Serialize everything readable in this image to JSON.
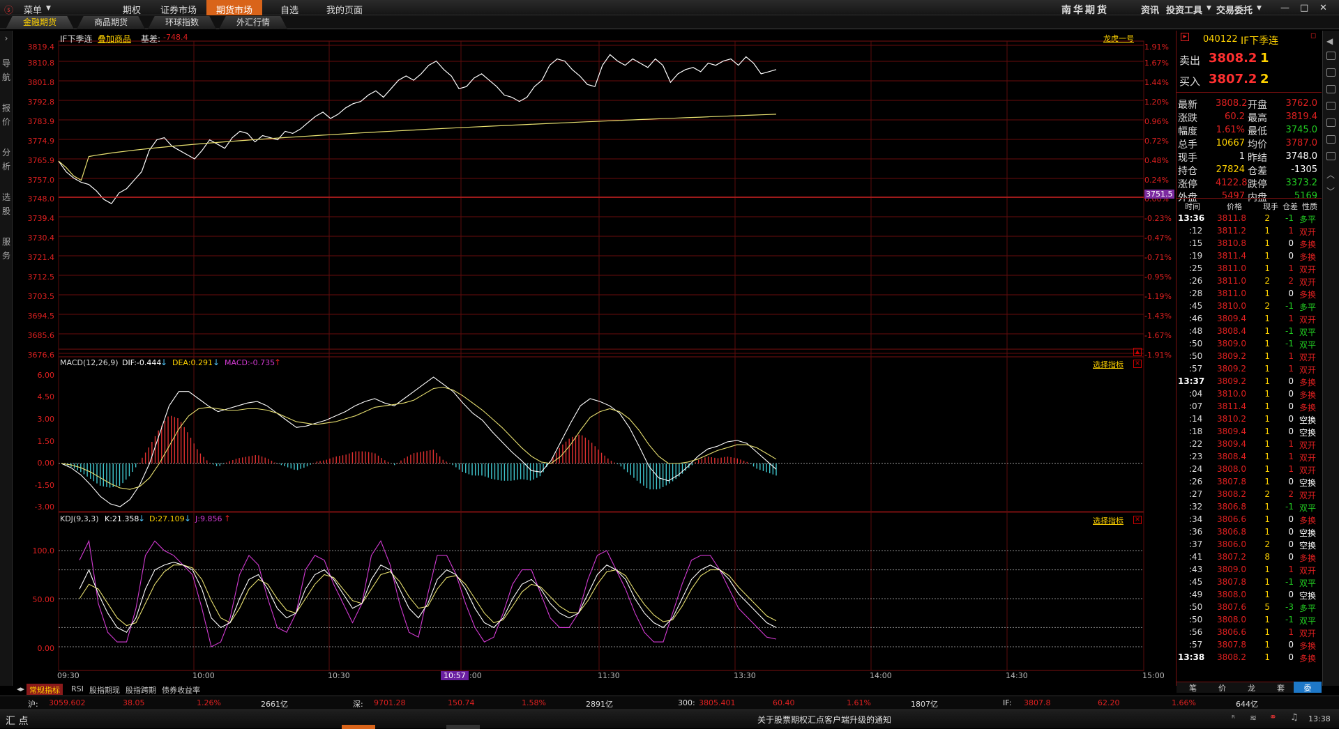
{
  "menubar": {
    "menu": "菜单",
    "items": [
      "期权",
      "证券市场",
      "期货市场",
      "自选",
      "我的页面"
    ],
    "brand": "南华期货",
    "right": [
      "资讯",
      "投资工具",
      "交易委托"
    ]
  },
  "subtabs": [
    "金融期货",
    "商品期货",
    "环球指数",
    "外汇行情"
  ],
  "left_strip": [
    "导",
    "航",
    "报",
    "价",
    "分",
    "析",
    "选",
    "股",
    "服",
    "务"
  ],
  "header": {
    "symbol": "IF下季连",
    "overlay": "叠加商品",
    "basis_label": "基差:",
    "basis": "-748.4",
    "dragon": "龙虎一号"
  },
  "price_axis": {
    "left": [
      "3819.4",
      "3810.8",
      "3801.8",
      "3792.8",
      "3783.9",
      "3774.9",
      "3765.9",
      "3757.0",
      "3748.0",
      "3739.4",
      "3730.4",
      "3721.4",
      "3712.5",
      "3703.5",
      "3694.5",
      "3685.6",
      "3676.6"
    ],
    "right": [
      "1.91%",
      "1.67%",
      "1.44%",
      "1.20%",
      "0.96%",
      "0.72%",
      "0.48%",
      "0.24%",
      "0.00%",
      "-0.23%",
      "-0.47%",
      "-0.71%",
      "-0.95%",
      "-1.19%",
      "-1.43%",
      "-1.67%",
      "-1.91%"
    ],
    "badge": "3751.5"
  },
  "macd": {
    "title": "MACD(12,26,9)",
    "dif": "DIF:-0.444",
    "dea": "DEA:0.291",
    "macd": "MACD:-0.735",
    "select": "选择指标",
    "axis": [
      "6.00",
      "4.50",
      "3.00",
      "1.50",
      "0.00",
      "-1.50",
      "-3.00"
    ]
  },
  "kdj": {
    "title": "KDJ(9,3,3)",
    "k": "K:21.358",
    "d": "D:27.109",
    "j": "J:9.856",
    "select": "选择指标",
    "axis": [
      "100.0",
      "50.00",
      "0.00"
    ]
  },
  "time_axis": [
    "09:30",
    "10:00",
    "10:30",
    "11:00",
    "11:30",
    "13:30",
    "14:00",
    "14:30",
    "15:00"
  ],
  "cursor_time": "10:57",
  "bottom_tabs": [
    "常规指标",
    "RSI",
    "股指期现",
    "股指跨期",
    "债券收益率"
  ],
  "quote": {
    "code": "040122",
    "name": "IF下季连",
    "sell_label": "卖出",
    "sell_price": "3808.2",
    "sell_vol": "1",
    "buy_label": "买入",
    "buy_price": "3807.2",
    "buy_vol": "2",
    "stats": [
      [
        "最新",
        "3808.2",
        "开盘",
        "3762.0"
      ],
      [
        "涨跌",
        "60.2",
        "最高",
        "3819.4"
      ],
      [
        "幅度",
        "1.61%",
        "最低",
        "3745.0"
      ],
      [
        "总手",
        "10667",
        "均价",
        "3787.0"
      ],
      [
        "现手",
        "1",
        "昨结",
        "3748.0"
      ],
      [
        "持仓",
        "27824",
        "仓差",
        "-1305"
      ],
      [
        "涨停",
        "4122.8",
        "跌停",
        "3373.2"
      ],
      [
        "外盘",
        "5497",
        "内盘",
        "5169"
      ]
    ],
    "tick_headers": [
      "时间",
      "价格",
      "现手",
      "仓差",
      "性质"
    ],
    "ticks": [
      [
        "13:36",
        "3811.8",
        "2",
        "-1",
        "多平"
      ],
      [
        ":12",
        "3811.2",
        "1",
        "1",
        "双开"
      ],
      [
        ":15",
        "3810.8",
        "1",
        "0",
        "多换"
      ],
      [
        ":19",
        "3811.4",
        "1",
        "0",
        "多换"
      ],
      [
        ":25",
        "3811.0",
        "1",
        "1",
        "双开"
      ],
      [
        ":26",
        "3811.0",
        "2",
        "2",
        "双开"
      ],
      [
        ":28",
        "3811.0",
        "1",
        "0",
        "多换"
      ],
      [
        ":45",
        "3810.0",
        "2",
        "-1",
        "多平"
      ],
      [
        ":46",
        "3809.4",
        "1",
        "1",
        "双开"
      ],
      [
        ":48",
        "3808.4",
        "1",
        "-1",
        "双平"
      ],
      [
        ":50",
        "3809.0",
        "1",
        "-1",
        "双平"
      ],
      [
        ":50",
        "3809.2",
        "1",
        "1",
        "双开"
      ],
      [
        ":57",
        "3809.2",
        "1",
        "1",
        "双开"
      ],
      [
        "13:37",
        "3809.2",
        "1",
        "0",
        "多换"
      ],
      [
        ":04",
        "3810.0",
        "1",
        "0",
        "多换"
      ],
      [
        ":07",
        "3811.4",
        "1",
        "0",
        "多换"
      ],
      [
        ":14",
        "3810.2",
        "1",
        "0",
        "空换"
      ],
      [
        ":18",
        "3809.4",
        "1",
        "0",
        "空换"
      ],
      [
        ":22",
        "3809.4",
        "1",
        "1",
        "双开"
      ],
      [
        ":23",
        "3808.4",
        "1",
        "1",
        "双开"
      ],
      [
        ":24",
        "3808.0",
        "1",
        "1",
        "双开"
      ],
      [
        ":26",
        "3807.8",
        "1",
        "0",
        "空换"
      ],
      [
        ":27",
        "3808.2",
        "2",
        "2",
        "双开"
      ],
      [
        ":32",
        "3806.8",
        "1",
        "-1",
        "双平"
      ],
      [
        ":34",
        "3806.6",
        "1",
        "0",
        "多换"
      ],
      [
        ":36",
        "3806.8",
        "1",
        "0",
        "空换"
      ],
      [
        ":37",
        "3806.0",
        "2",
        "0",
        "空换"
      ],
      [
        ":41",
        "3807.2",
        "8",
        "0",
        "多换"
      ],
      [
        ":43",
        "3809.0",
        "1",
        "1",
        "双开"
      ],
      [
        ":45",
        "3807.8",
        "1",
        "-1",
        "双平"
      ],
      [
        ":49",
        "3808.0",
        "1",
        "0",
        "空换"
      ],
      [
        ":50",
        "3807.6",
        "5",
        "-3",
        "多平"
      ],
      [
        ":50",
        "3808.0",
        "1",
        "-1",
        "双平"
      ],
      [
        ":56",
        "3806.6",
        "1",
        "1",
        "双开"
      ],
      [
        ":57",
        "3807.8",
        "1",
        "0",
        "多换"
      ],
      [
        "13:38",
        "3808.2",
        "1",
        "0",
        "多换"
      ]
    ],
    "bottom_tabs": [
      "笔",
      "价",
      "龙",
      "套",
      "委"
    ]
  },
  "statusbar": [
    [
      "沪:",
      "3059.602",
      "38.05",
      "1.26%",
      "2661亿"
    ],
    [
      "深:",
      "9701.28",
      "150.74",
      "1.58%",
      "2891亿"
    ],
    [
      "300:",
      "3805.401",
      "60.40",
      "1.61%",
      "1807亿"
    ],
    [
      "IF:",
      "3807.8",
      "62.20",
      "1.66%",
      "644亿"
    ]
  ],
  "footer": {
    "left": "汇 点",
    "notice": "关于股票期权汇点客户端升级的通知",
    "time": "13:38"
  },
  "chart_data": {
    "type": "line",
    "title": "IF下季连",
    "yrange": [
      3676.6,
      3819.4
    ],
    "prev_settle": 3748.0,
    "price": [
      3765,
      3760,
      3757,
      3755,
      3754,
      3751,
      3747,
      3745,
      3750,
      3752,
      3756,
      3760,
      3770,
      3775,
      3776,
      3772,
      3770,
      3768,
      3766,
      3770,
      3775,
      3773,
      3771,
      3776,
      3779,
      3778,
      3774,
      3777,
      3776,
      3775,
      3779,
      3778,
      3780,
      3783,
      3786,
      3788,
      3785,
      3787,
      3790,
      3792,
      3793,
      3796,
      3798,
      3795,
      3799,
      3803,
      3805,
      3803,
      3806,
      3810,
      3812,
      3808,
      3805,
      3799,
      3800,
      3804,
      3806,
      3803,
      3800,
      3796,
      3795,
      3793,
      3795,
      3800,
      3803,
      3810,
      3813,
      3812,
      3808,
      3805,
      3801,
      3800,
      3810,
      3815,
      3812,
      3810,
      3813,
      3811,
      3809,
      3813,
      3810,
      3802,
      3806,
      3808,
      3809,
      3807,
      3811,
      3810,
      3812,
      3813,
      3810,
      3814,
      3811,
      3806,
      3807,
      3808
    ],
    "avg_start": 3762,
    "avg_end": 3787,
    "macd_dif": [
      0,
      -0.3,
      -0.8,
      -1.5,
      -2.3,
      -2.8,
      -3.0,
      -2.5,
      -1.5,
      0,
      2,
      4,
      5,
      5,
      4.5,
      4,
      3.6,
      3.8,
      4,
      4.2,
      4.3,
      4,
      3.5,
      3,
      2.5,
      2.6,
      2.8,
      3,
      3.3,
      3.6,
      4,
      4.3,
      4.5,
      4.2,
      4,
      4.5,
      5,
      5.5,
      6,
      5.5,
      5,
      4.2,
      3.5,
      3,
      2.2,
      1.5,
      0.8,
      0.2,
      -0.5,
      -0.6,
      0.2,
      1.5,
      2.8,
      4,
      4.5,
      4.3,
      4,
      3.5,
      2.5,
      1.2,
      -0.2,
      -1,
      -1.2,
      -0.8,
      -0.2,
      0.5,
      1,
      1.2,
      1.5,
      1.6,
      1.4,
      0.8,
      0.2,
      -0.4
    ],
    "macd_dea": [
      0,
      -0.1,
      -0.3,
      -0.6,
      -1,
      -1.4,
      -1.7,
      -1.8,
      -1.6,
      -1,
      0,
      1.2,
      2.4,
      3.3,
      3.8,
      3.9,
      3.8,
      3.7,
      3.7,
      3.8,
      3.8,
      3.7,
      3.5,
      3.2,
      2.9,
      2.8,
      2.7,
      2.8,
      2.9,
      3.1,
      3.3,
      3.6,
      3.9,
      4,
      4.1,
      4.2,
      4.4,
      4.8,
      5.2,
      5.3,
      5.1,
      4.7,
      4.2,
      3.7,
      3.1,
      2.5,
      1.8,
      1.1,
      0.5,
      0.1,
      0,
      0.5,
      1.3,
      2.3,
      3.2,
      3.6,
      3.8,
      3.6,
      3.1,
      2.3,
      1.3,
      0.5,
      0,
      0,
      0.1,
      0.3,
      0.6,
      0.9,
      1.1,
      1.3,
      1.3,
      1.1,
      0.7,
      0.3
    ],
    "kdj_k": [
      60,
      80,
      55,
      35,
      20,
      15,
      30,
      60,
      80,
      85,
      88,
      85,
      80,
      60,
      30,
      20,
      25,
      50,
      70,
      75,
      60,
      40,
      30,
      35,
      60,
      75,
      80,
      70,
      55,
      40,
      45,
      70,
      85,
      80,
      60,
      40,
      30,
      45,
      70,
      80,
      75,
      60,
      40,
      25,
      20,
      30,
      50,
      65,
      70,
      60,
      45,
      35,
      30,
      35,
      55,
      75,
      85,
      80,
      70,
      50,
      35,
      25,
      20,
      30,
      50,
      70,
      80,
      85,
      80,
      70,
      55,
      45,
      35,
      25,
      20
    ],
    "kdj_d": [
      50,
      65,
      60,
      45,
      30,
      22,
      25,
      45,
      65,
      78,
      85,
      85,
      82,
      70,
      48,
      30,
      25,
      40,
      60,
      70,
      65,
      50,
      38,
      35,
      50,
      65,
      75,
      72,
      60,
      48,
      45,
      60,
      75,
      78,
      68,
      52,
      40,
      42,
      60,
      72,
      74,
      65,
      50,
      35,
      25,
      28,
      42,
      57,
      65,
      62,
      52,
      42,
      36,
      35,
      48,
      65,
      78,
      80,
      74,
      58,
      44,
      33,
      26,
      28,
      42,
      60,
      74,
      80,
      80,
      74,
      62,
      52,
      42,
      32,
      27
    ],
    "kdj_j": [
      90,
      110,
      45,
      15,
      5,
      5,
      40,
      95,
      110,
      100,
      95,
      85,
      75,
      40,
      0,
      5,
      30,
      75,
      95,
      85,
      50,
      20,
      15,
      35,
      80,
      95,
      90,
      65,
      45,
      25,
      45,
      95,
      110,
      85,
      45,
      15,
      10,
      55,
      95,
      95,
      75,
      45,
      20,
      5,
      10,
      35,
      65,
      80,
      80,
      55,
      30,
      20,
      20,
      35,
      70,
      95,
      100,
      80,
      60,
      35,
      15,
      5,
      5,
      35,
      65,
      90,
      95,
      95,
      80,
      60,
      40,
      30,
      20,
      10,
      8
    ]
  }
}
